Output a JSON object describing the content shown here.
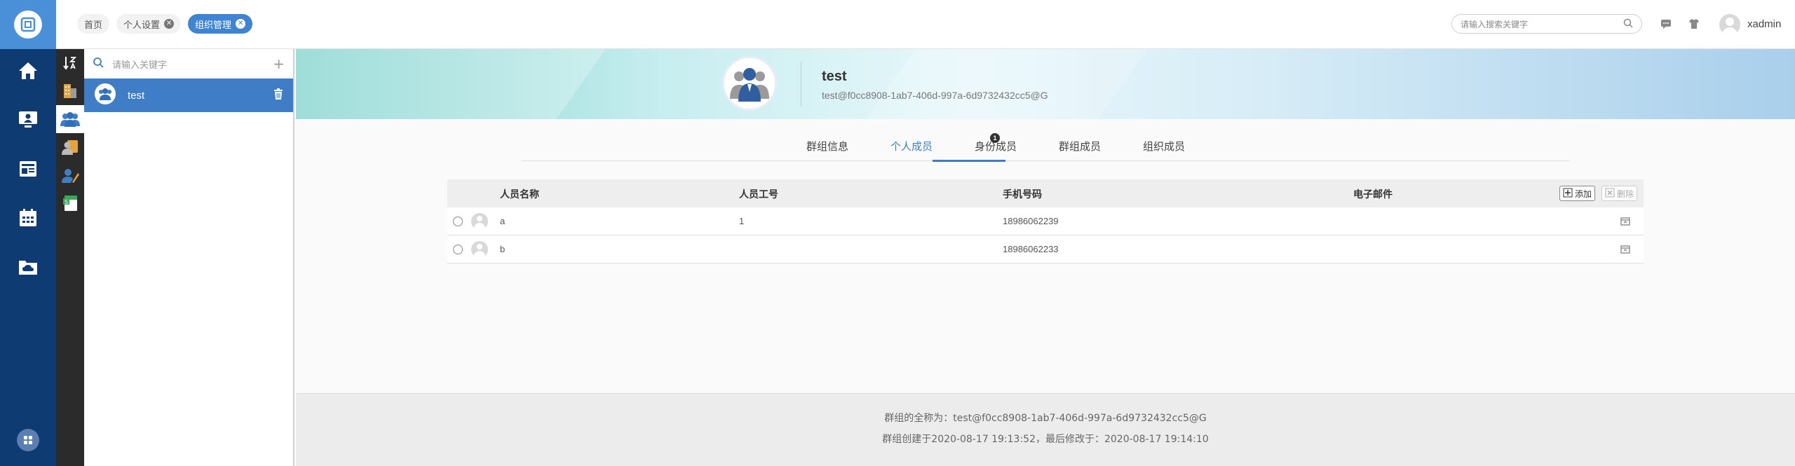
{
  "app": {
    "user_name": "xadmin"
  },
  "page_tabs": [
    {
      "label": "首页",
      "closable": false,
      "active": false
    },
    {
      "label": "个人设置",
      "closable": true,
      "active": false
    },
    {
      "label": "组织管理",
      "closable": true,
      "active": true
    }
  ],
  "top_search": {
    "placeholder": "请输入搜索关键字"
  },
  "left_nav": [
    "home-icon",
    "monitor-user-icon",
    "news-icon",
    "calendar-icon",
    "cloud-folder-icon"
  ],
  "icon_bar": [
    "sort-icon",
    "buildings-icon",
    "group-icon",
    "person-card-icon",
    "person-edit-icon",
    "sheet-icon"
  ],
  "group_list": {
    "search_placeholder": "请输入关键字",
    "items": [
      {
        "name": "test",
        "selected": true
      }
    ]
  },
  "group_header": {
    "name": "test",
    "id": "test@f0cc8908-1ab7-406d-997a-6d9732432cc5@G"
  },
  "subtabs": [
    {
      "label": "群组信息",
      "active": false
    },
    {
      "label": "个人成员",
      "active": true,
      "badge": "1"
    },
    {
      "label": "身份成员",
      "active": false
    },
    {
      "label": "群组成员",
      "active": false
    },
    {
      "label": "组织成员",
      "active": false
    }
  ],
  "members_table": {
    "columns": [
      "人员名称",
      "人员工号",
      "手机号码",
      "电子邮件"
    ],
    "add_label": "添加",
    "delete_label": "删除",
    "rows": [
      {
        "name": "a",
        "employee_no": "1",
        "mobile": "18986062239",
        "email": ""
      },
      {
        "name": "b",
        "employee_no": "",
        "mobile": "18986062233",
        "email": ""
      }
    ]
  },
  "footer": {
    "full_name": "群组的全称为：test@f0cc8908-1ab7-406d-997a-6d9732432cc5@G",
    "timestamps": "群组创建于2020-08-17 19:13:52，最后修改于：2020-08-17 19:14:10"
  },
  "colors": {
    "accent": "#3f7ec7",
    "nav_bg": "#0f3b73",
    "iconbar_bg": "#2b2b2b",
    "logo_bg": "#4a90d9"
  }
}
